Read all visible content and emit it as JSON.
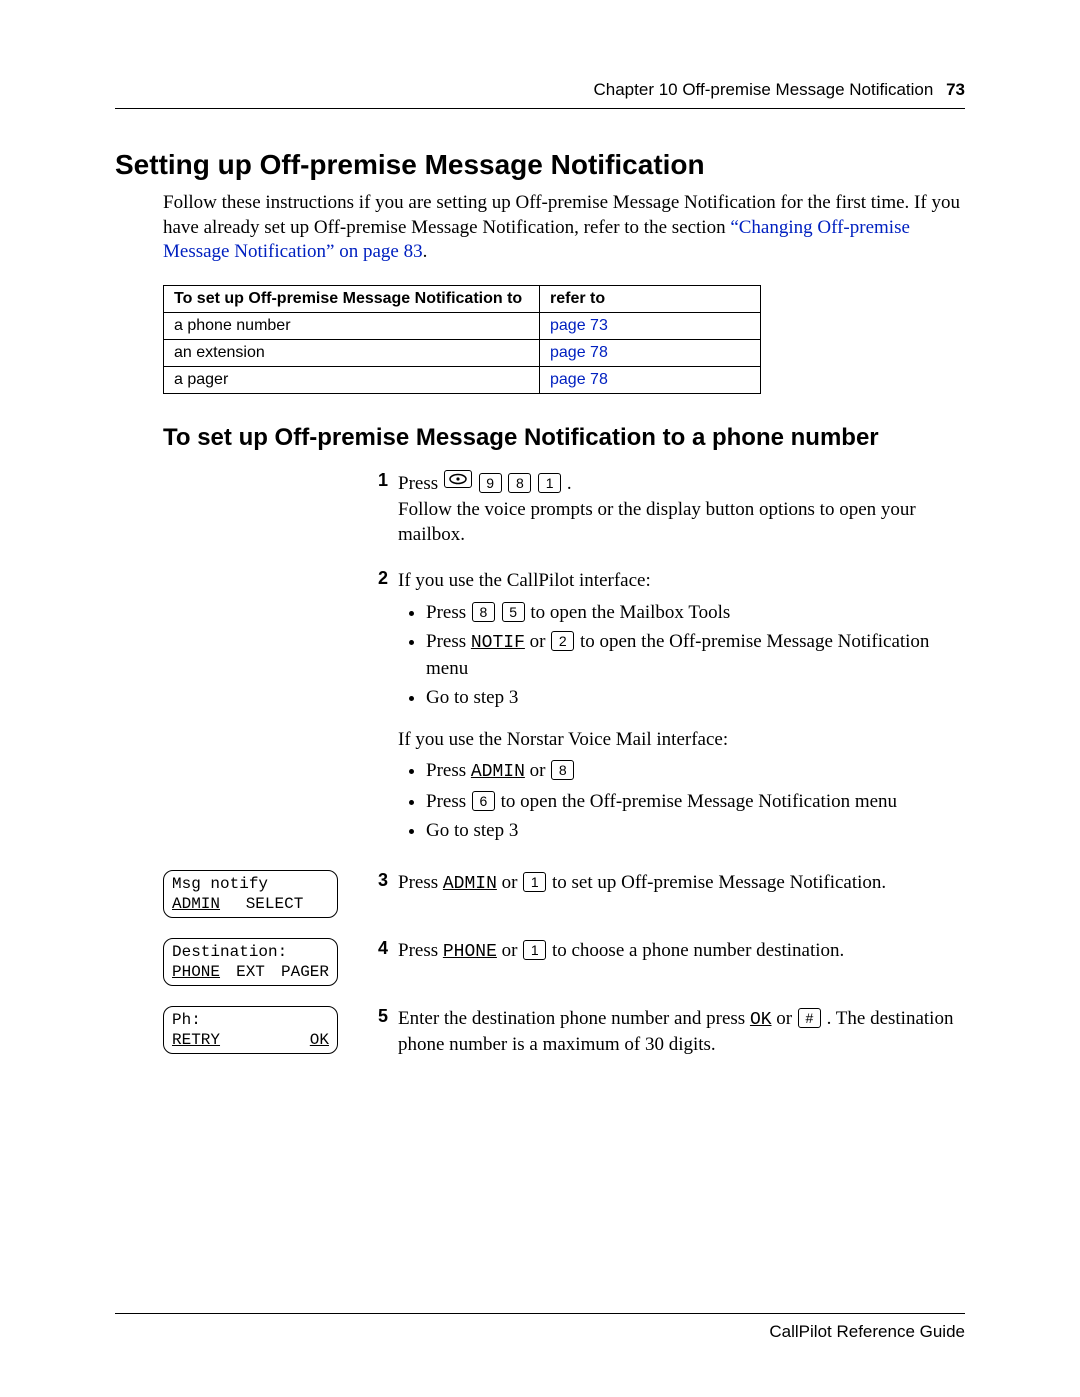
{
  "header": {
    "chapter": "Chapter 10  Off-premise Message Notification",
    "page_number": "73"
  },
  "title": "Setting up Off-premise Message Notification",
  "intro": {
    "text_before_link": "Follow these instructions if you are setting up Off-premise Message Notification for the first time. If you have already set up Off-premise Message Notification, refer to the section ",
    "link_text": "“Changing Off-premise Message Notification” on page 83",
    "text_after_link": "."
  },
  "table": {
    "header": {
      "col1": "To set up Off-premise Message Notification to",
      "col2": "refer to"
    },
    "rows": [
      {
        "label": "a phone number",
        "ref": "page 73"
      },
      {
        "label": "an extension",
        "ref": "page 78"
      },
      {
        "label": "a pager",
        "ref": "page 78"
      }
    ]
  },
  "subheading": "To set up Off-premise Message Notification to a phone number",
  "steps": {
    "s1": {
      "num": "1",
      "press": "Press ",
      "keys": [
        "feature",
        "9",
        "8",
        "1"
      ],
      "after": ".",
      "line2": "Follow the voice prompts or the display button options to open your mailbox."
    },
    "s2": {
      "num": "2",
      "intro": "If you use the CallPilot interface:",
      "b1_a": "Press ",
      "b1_k1": "8",
      "b1_k2": "5",
      "b1_b": " to open the Mailbox Tools",
      "b2_a": "Press ",
      "b2_sk": "NOTIF",
      "b2_b": " or ",
      "b2_k": "2",
      "b2_c": " to open the Off-premise Message Notification menu",
      "b3": "Go to step 3",
      "intro2": "If you use the Norstar Voice Mail interface:",
      "c1_a": "Press ",
      "c1_sk": "ADMIN",
      "c1_b": " or ",
      "c1_k": "8",
      "c2_a": "Press ",
      "c2_k": "6",
      "c2_b": " to open the Off-premise Message Notification menu",
      "c3": "Go to step 3"
    },
    "s3": {
      "num": "3",
      "a": "Press ",
      "sk": "ADMIN",
      "b": " or ",
      "k": "1",
      "c": " to set up Off-premise Message Notification.",
      "display": {
        "line1": "Msg notify",
        "opt1": "ADMIN",
        "opt2": "SELECT"
      }
    },
    "s4": {
      "num": "4",
      "a": "Press ",
      "sk": "PHONE",
      "b": " or ",
      "k": "1",
      "c": " to choose a phone number destination.",
      "display": {
        "line1": "Destination:",
        "opt1": "PHONE",
        "opt2": "EXT",
        "opt3": "PAGER"
      }
    },
    "s5": {
      "num": "5",
      "a": "Enter the destination phone number and press ",
      "sk": "OK",
      "b": " or ",
      "k": "#",
      "c": ". The destination phone number is a maximum of 30 digits.",
      "display": {
        "line1": "Ph:",
        "opt1": "RETRY",
        "opt3": "OK"
      }
    }
  },
  "footer": "CallPilot Reference Guide"
}
